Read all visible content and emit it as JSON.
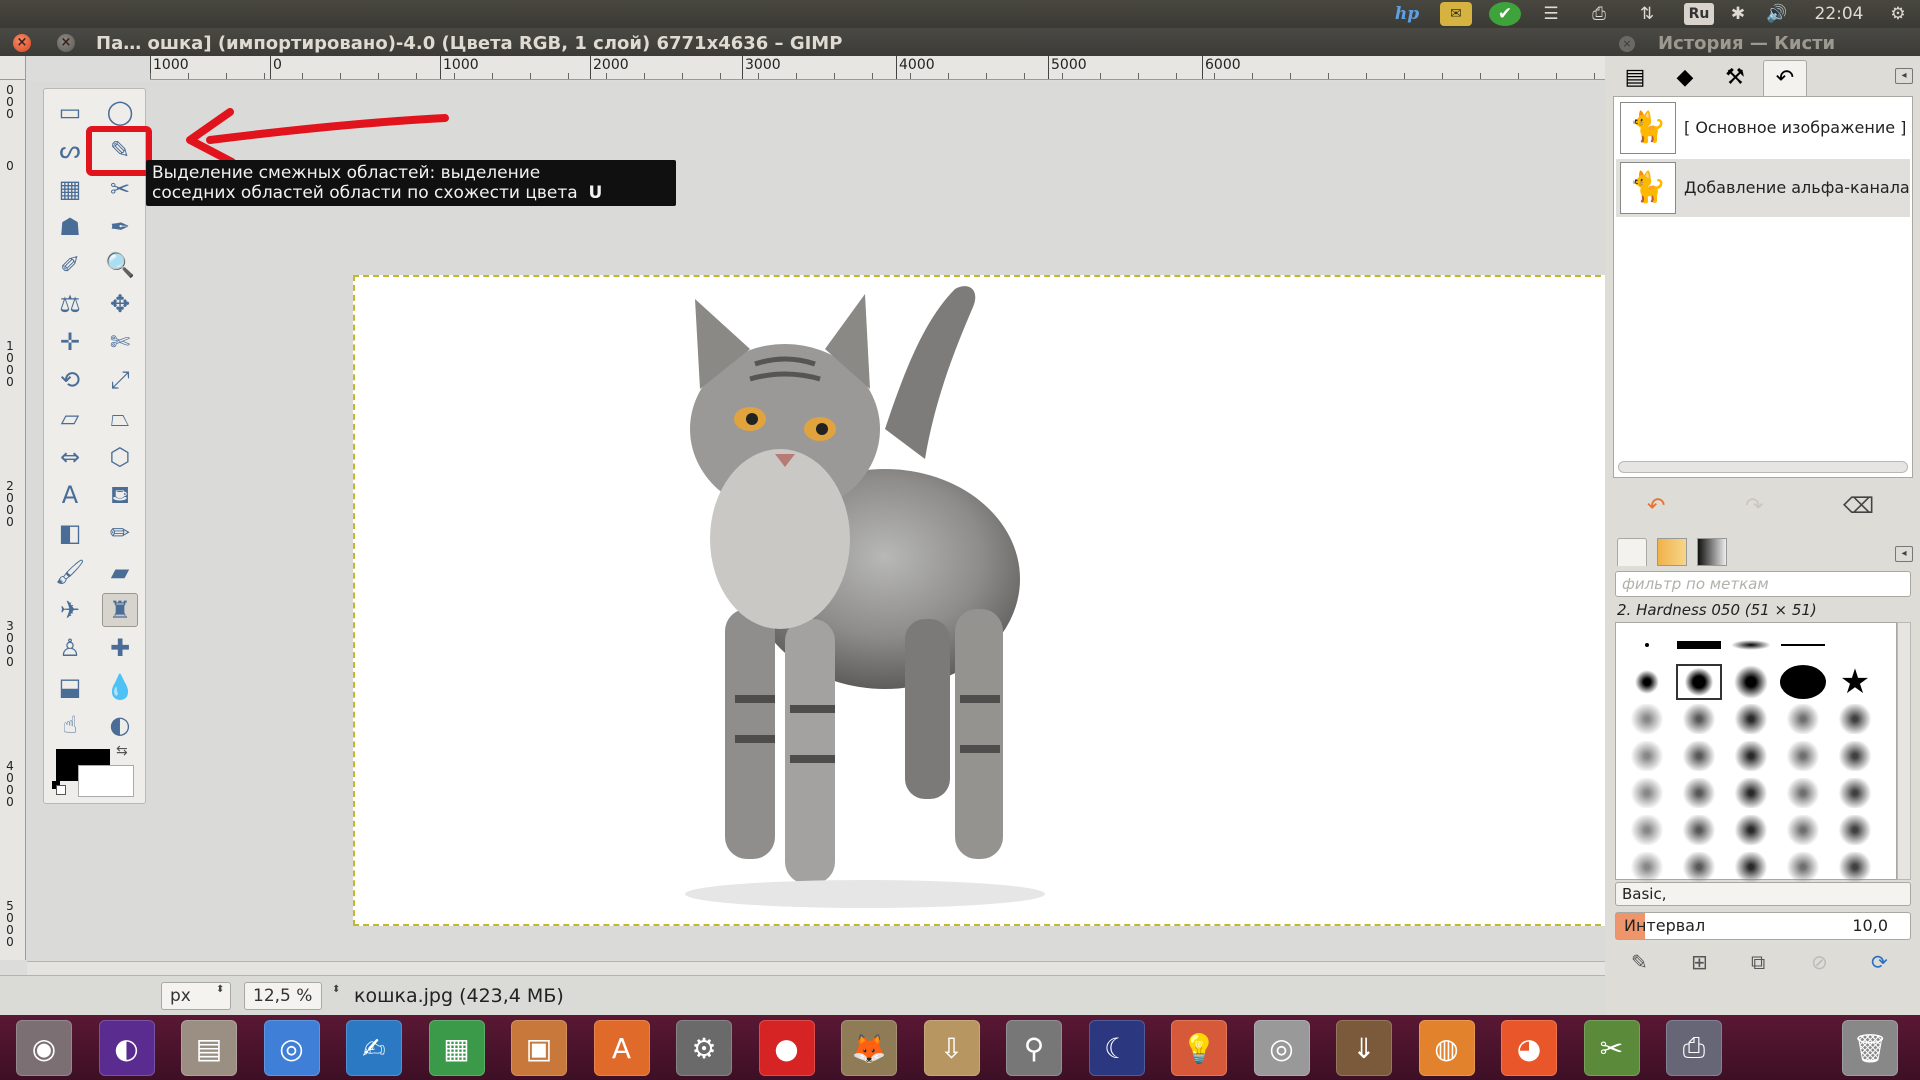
{
  "window": {
    "title": "Па… ошка] (импортировано)-4.0 (Цвета RGB, 1 слой) 6771x4636 – GIMP",
    "close_glyph": "×",
    "minimize_glyph": "×"
  },
  "top_panel": {
    "hp": "hp",
    "keyring_glyph": "✉",
    "check_glyph": "✔",
    "menu_glyph": "☰",
    "printer_glyph": "⎙",
    "network_glyph": "⇅",
    "language": "Ru",
    "bluetooth_glyph": "✱",
    "volume_glyph": "🔊",
    "clock": "22:04",
    "power_glyph": "⚙"
  },
  "ruler": {
    "h_labels": [
      "1000",
      "0",
      "1000",
      "2000",
      "3000",
      "4000",
      "5000",
      "6000"
    ],
    "v_labels": [
      "000",
      "0",
      "1000",
      "2000",
      "3000",
      "4000",
      "5000"
    ]
  },
  "toolbox": {
    "tools": [
      {
        "name": "rect-select-icon",
        "glyph": "▭"
      },
      {
        "name": "ellipse-select-icon",
        "glyph": "◯"
      },
      {
        "name": "free-select-icon",
        "glyph": "ᔕ"
      },
      {
        "name": "fuzzy-select-icon",
        "glyph": "✎"
      },
      {
        "name": "select-by-color-icon",
        "glyph": "▦"
      },
      {
        "name": "scissors-select-icon",
        "glyph": "✂"
      },
      {
        "name": "foreground-select-icon",
        "glyph": "☗"
      },
      {
        "name": "paths-icon",
        "glyph": "✒"
      },
      {
        "name": "color-picker-icon",
        "glyph": "✐"
      },
      {
        "name": "zoom-icon",
        "glyph": "🔍"
      },
      {
        "name": "measure-icon",
        "glyph": "⚖"
      },
      {
        "name": "move-icon",
        "glyph": "✥"
      },
      {
        "name": "align-icon",
        "glyph": "✛"
      },
      {
        "name": "crop-icon",
        "glyph": "✄"
      },
      {
        "name": "rotate-icon",
        "glyph": "⟲"
      },
      {
        "name": "scale-icon",
        "glyph": "⤢"
      },
      {
        "name": "shear-icon",
        "glyph": "▱"
      },
      {
        "name": "perspective-icon",
        "glyph": "⏢"
      },
      {
        "name": "flip-icon",
        "glyph": "⇔"
      },
      {
        "name": "cage-transform-icon",
        "glyph": "⬡"
      },
      {
        "name": "text-icon",
        "glyph": "A"
      },
      {
        "name": "bucket-fill-icon",
        "glyph": "⛾"
      },
      {
        "name": "gradient-icon",
        "glyph": "◧"
      },
      {
        "name": "pencil-icon",
        "glyph": "✏"
      },
      {
        "name": "paintbrush-icon",
        "glyph": "🖌"
      },
      {
        "name": "eraser-icon",
        "glyph": "▰"
      },
      {
        "name": "airbrush-icon",
        "glyph": "✈"
      },
      {
        "name": "ink-icon",
        "glyph": "♜"
      },
      {
        "name": "clone-icon",
        "glyph": "♙"
      },
      {
        "name": "heal-icon",
        "glyph": "✚"
      },
      {
        "name": "perspective-clone-icon",
        "glyph": "⬓"
      },
      {
        "name": "blur-icon",
        "glyph": "💧"
      },
      {
        "name": "smudge-icon",
        "glyph": "☝"
      },
      {
        "name": "dodge-burn-icon",
        "glyph": "◐"
      }
    ],
    "swap_glyph": "⇆"
  },
  "tooltip": {
    "line1": "Выделение смежных областей: выделение",
    "line2": "соседних областей области по схожести цвета",
    "shortcut": "U"
  },
  "statusbar": {
    "unit": "px",
    "zoom": "12,5 %",
    "spin_glyph": "⬍",
    "info": "кошка.jpg (423,4 МБ)"
  },
  "dock": {
    "title": "История — Кисти",
    "close_glyph": "×",
    "tabs": [
      "▤",
      "◆",
      "⚒",
      "↶"
    ],
    "menu_glyph": "◂",
    "history": [
      {
        "label": "[ Основное изображение ]",
        "thumb": "🐈"
      },
      {
        "label": "Добавление альфа-канала",
        "thumb": "🐈"
      }
    ],
    "undo_glyph": "↶",
    "redo_glyph": "↷",
    "clear_glyph": "⌫",
    "brush_filter_placeholder": "фильтр по меткам",
    "brush_name": "2. Hardness 050 (51 × 51)",
    "brush_set": "Basic,",
    "spacing_label": "Интервал",
    "spacing_value": "10,0",
    "spacing_fraction": 0.1,
    "brush_buttons": [
      "✎",
      "⊞",
      "⧉",
      "⊘",
      "⟳"
    ]
  },
  "launcher": {
    "apps": [
      {
        "name": "ubuntu-dash-icon",
        "glyph": "◉"
      },
      {
        "name": "media-player-icon",
        "glyph": "◐"
      },
      {
        "name": "files-icon",
        "glyph": "▤"
      },
      {
        "name": "chrome-icon",
        "glyph": "◎"
      },
      {
        "name": "writer-icon",
        "glyph": "✍"
      },
      {
        "name": "calc-icon",
        "glyph": "▦"
      },
      {
        "name": "impress-icon",
        "glyph": "▣"
      },
      {
        "name": "software-center-icon",
        "glyph": "A"
      },
      {
        "name": "system-settings-icon",
        "glyph": "⚙"
      },
      {
        "name": "recorder-icon",
        "glyph": "●"
      },
      {
        "name": "gimp-icon",
        "glyph": "🦊"
      },
      {
        "name": "archive-icon",
        "glyph": "⇩"
      },
      {
        "name": "usb-icon",
        "glyph": "⚲"
      },
      {
        "name": "stellarium-icon",
        "glyph": "☾"
      },
      {
        "name": "idea-icon",
        "glyph": "💡"
      },
      {
        "name": "disc-icon",
        "glyph": "◎"
      },
      {
        "name": "installer-icon",
        "glyph": "⇓"
      },
      {
        "name": "blender-icon",
        "glyph": "◍"
      },
      {
        "name": "firefox-icon",
        "glyph": "◕"
      },
      {
        "name": "screenshot-icon",
        "glyph": "✂"
      },
      {
        "name": "scanner-icon",
        "glyph": "⎙"
      },
      {
        "name": "trash-icon",
        "glyph": "🗑"
      }
    ]
  },
  "colors": {
    "highlight": "#e1141d",
    "selection_border": "#c2b92a",
    "launcher": "#4a1430"
  }
}
